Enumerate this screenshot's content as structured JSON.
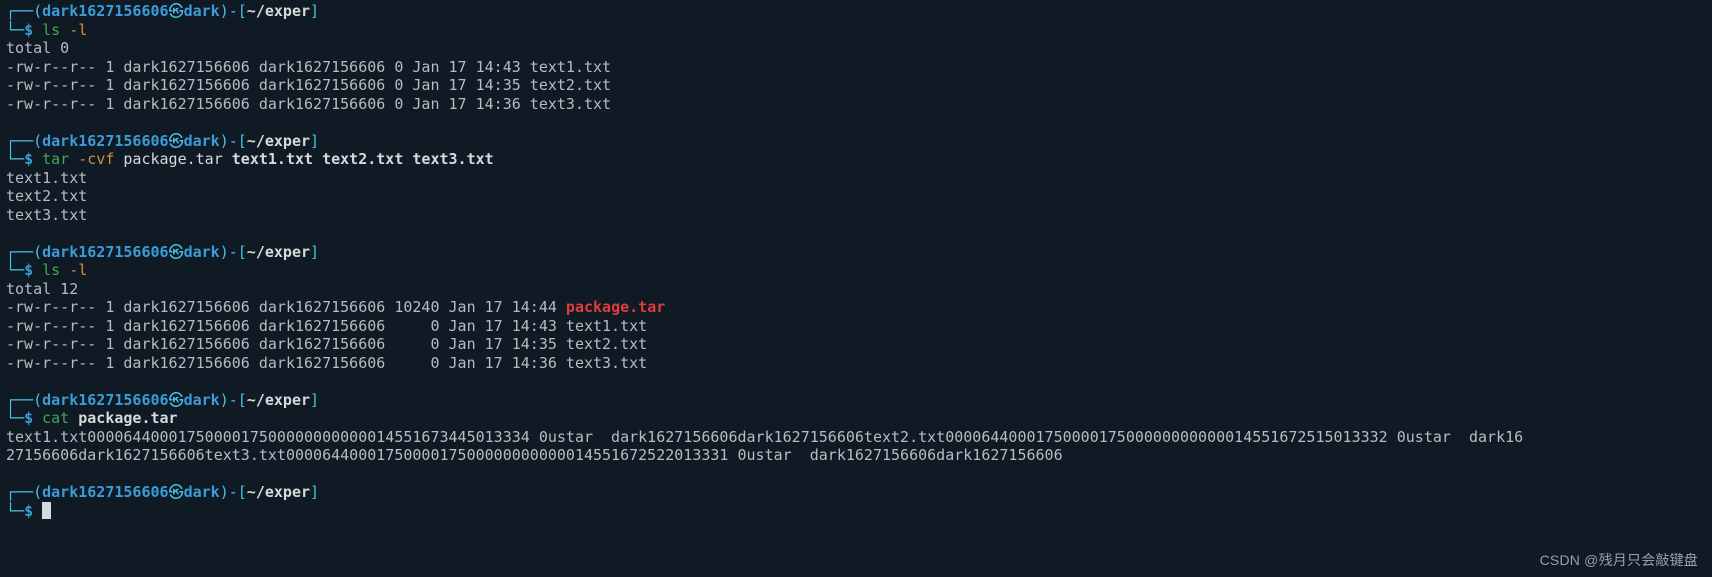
{
  "prompt": {
    "user": "dark1627156606",
    "skull": "㉿",
    "host": "dark",
    "path": "~/exper",
    "lparen": "(",
    "rparen": ")",
    "dash": "-",
    "lbrack": "[",
    "rbrack": "]",
    "corner_top": "┌──",
    "corner_bot": "└─",
    "dollar": "$"
  },
  "blocks": [
    {
      "cmd": [
        {
          "t": "ls",
          "c": "green"
        },
        {
          "t": " ",
          "c": "white"
        },
        {
          "t": "-l",
          "c": "orange"
        }
      ],
      "out": [
        "total 0",
        "-rw-r--r-- 1 dark1627156606 dark1627156606 0 Jan 17 14:43 text1.txt",
        "-rw-r--r-- 1 dark1627156606 dark1627156606 0 Jan 17 14:35 text2.txt",
        "-rw-r--r-- 1 dark1627156606 dark1627156606 0 Jan 17 14:36 text3.txt"
      ]
    },
    {
      "cmd": [
        {
          "t": "tar",
          "c": "green"
        },
        {
          "t": " ",
          "c": "white"
        },
        {
          "t": "-cvf",
          "c": "orange"
        },
        {
          "t": " package.tar ",
          "c": "white"
        },
        {
          "t": "text1.txt text2.txt text3.txt",
          "c": "white bold"
        }
      ],
      "out": [
        "text1.txt",
        "text2.txt",
        "text3.txt"
      ]
    },
    {
      "cmd": [
        {
          "t": "ls",
          "c": "green"
        },
        {
          "t": " ",
          "c": "white"
        },
        {
          "t": "-l",
          "c": "orange"
        }
      ],
      "out_rich": [
        [
          {
            "t": "total 12",
            "c": "grey"
          }
        ],
        [
          {
            "t": "-rw-r--r-- 1 dark1627156606 dark1627156606 10240 Jan 17 14:44 ",
            "c": "grey"
          },
          {
            "t": "package.tar",
            "c": "red"
          }
        ],
        [
          {
            "t": "-rw-r--r-- 1 dark1627156606 dark1627156606     0 Jan 17 14:43 text1.txt",
            "c": "grey"
          }
        ],
        [
          {
            "t": "-rw-r--r-- 1 dark1627156606 dark1627156606     0 Jan 17 14:35 text2.txt",
            "c": "grey"
          }
        ],
        [
          {
            "t": "-rw-r--r-- 1 dark1627156606 dark1627156606     0 Jan 17 14:36 text3.txt",
            "c": "grey"
          }
        ]
      ]
    },
    {
      "cmd": [
        {
          "t": "cat",
          "c": "green"
        },
        {
          "t": " ",
          "c": "white"
        },
        {
          "t": "package.tar",
          "c": "white bold"
        }
      ],
      "out": [
        "text1.txt0000644000175000017500000000000014551673445013334 0ustar  dark1627156606dark1627156606text2.txt0000644000175000017500000000000014551672515013332 0ustar  dark16",
        "27156606dark1627156606text3.txt0000644000175000017500000000000014551672522013331 0ustar  dark1627156606dark1627156606"
      ]
    },
    {
      "cmd": [],
      "cursor": true
    }
  ],
  "watermark": "CSDN @残月只会敲键盘"
}
